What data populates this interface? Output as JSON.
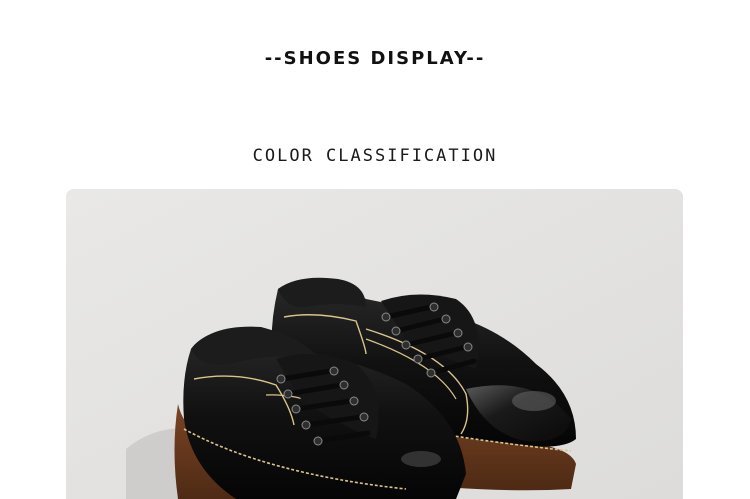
{
  "header": {
    "title": "--SHOES DISPLAY--",
    "subtitle": "COLOR CLASSIFICATION"
  },
  "product_image": {
    "subject": "black-leather-lace-up-shoes",
    "background_color": "#e5e4e2",
    "leather_color": "#121212",
    "sole_color": "#6b3a1e",
    "stitch_color": "#d9c48a"
  }
}
